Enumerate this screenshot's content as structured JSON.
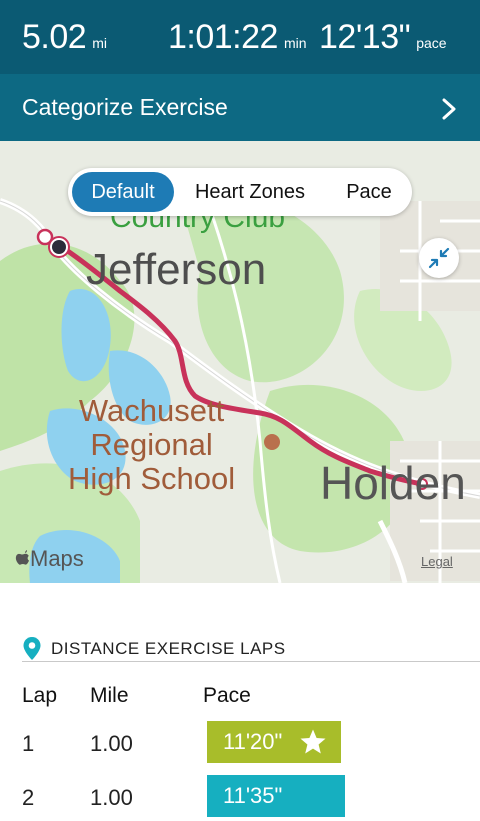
{
  "summary": {
    "distance": {
      "value": "5.02",
      "unit": "mi"
    },
    "duration": {
      "value": "1:01:22",
      "unit": "min"
    },
    "pace": {
      "value": "12'13\"",
      "unit": "pace"
    }
  },
  "categorize": {
    "label": "Categorize Exercise",
    "icon": "chevron-right-icon"
  },
  "map": {
    "segments": [
      {
        "label": "Default",
        "selected": true
      },
      {
        "label": "Heart Zones",
        "selected": false
      },
      {
        "label": "Pace",
        "selected": false
      }
    ],
    "labels": {
      "country_club": "Country Club",
      "town1": "Jefferson",
      "school_line1": "Wachusett",
      "school_line2": "Regional",
      "school_line3": "High School",
      "town2": "Holden",
      "attribution": "Maps",
      "legal": "Legal"
    },
    "collapse_icon": "collapse-arrows-icon",
    "route_color": "#c8325a"
  },
  "laps": {
    "title": "DISTANCE EXERCISE LAPS",
    "icon": "location-pin-icon",
    "headers": {
      "lap": "Lap",
      "mile": "Mile",
      "pace": "Pace"
    },
    "rows": [
      {
        "lap": "1",
        "mile": "1.00",
        "pace": "11'20\"",
        "color": "#a8bd2a",
        "best": true,
        "bar_fraction": 1.0
      },
      {
        "lap": "2",
        "mile": "1.00",
        "pace": "11'35\"",
        "color": "#16afc0",
        "best": false,
        "bar_fraction": 1.03
      }
    ]
  },
  "colors": {
    "header_bg": "#0b5a73",
    "categorize_bg": "#0d6983",
    "segment_selected": "#1e7bb5"
  }
}
